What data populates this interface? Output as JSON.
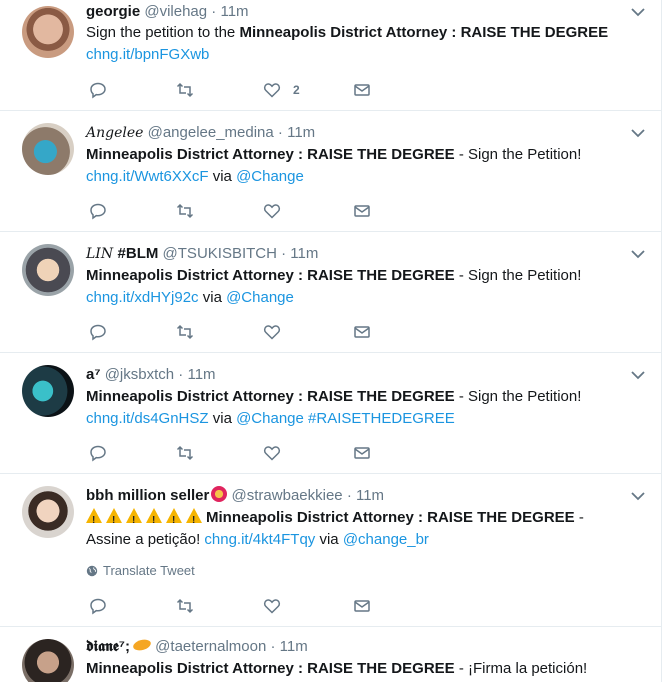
{
  "tweets": [
    {
      "display_name": "georgie",
      "handle": "@vilehag",
      "sep": "·",
      "time": "11m",
      "text_pre": "Sign the petition to the ",
      "text_bold": "Minneapolis District Attorney : RAISE THE DEGREE",
      "text_post": "",
      "link": "chng.it/bpnFGXwb",
      "like_count": "2"
    },
    {
      "display_name": "Angelee",
      "handle": "@angelee_medina",
      "sep": "·",
      "time": "11m",
      "text_bold": "Minneapolis District Attorney : RAISE THE DEGREE",
      "text_post": " - Sign the Petition!",
      "link": "chng.it/Wwt6XXcF",
      "via": " via ",
      "mention": "@Change"
    },
    {
      "display_name": "LIN",
      "display_tag": "#BLM",
      "handle": "@TSUKISBITCH",
      "sep": "·",
      "time": "11m",
      "text_bold": "Minneapolis District Attorney : RAISE THE DEGREE",
      "text_post": " - Sign the Petition!",
      "link": "chng.it/xdHYj92c",
      "via": " via ",
      "mention": "@Change"
    },
    {
      "display_name": "a⁷",
      "handle": "@jksbxtch",
      "sep": "·",
      "time": "11m",
      "text_bold": "Minneapolis District Attorney : RAISE THE DEGREE",
      "text_post": " - Sign the Petition!",
      "link": "chng.it/ds4GnHSZ",
      "via": " via ",
      "mention": "@Change",
      "hashtag": "#RAISETHEDEGREE"
    },
    {
      "display_name": "bbh million seller",
      "handle": "@strawbaekkiee",
      "sep": "·",
      "time": "11m",
      "text_bold": "Minneapolis District Attorney : RAISE THE DEGREE",
      "text_post": " -",
      "text_line2": "Assine a petição! ",
      "link": "chng.it/4kt4FTqy",
      "via": " via ",
      "mention": "@change_br",
      "translate": "Translate Tweet"
    },
    {
      "display_name": "𝖉𝖎𝖆𝖓𝖊⁷;",
      "handle": "@taeternalmoon",
      "sep": "·",
      "time": "11m",
      "text_bold": "Minneapolis District Attorney : RAISE THE DEGREE",
      "text_post": " - ¡Firma la petición!"
    }
  ],
  "icons": {
    "reply": "reply-icon",
    "retweet": "retweet-icon",
    "like": "heart-icon",
    "dm": "envelope-icon",
    "caret": "chevron-down-icon",
    "globe": "globe-icon",
    "warning": "warning-icon"
  },
  "colors": {
    "link": "#1b95e0",
    "muted": "#657786",
    "text": "#14171a",
    "divider": "#e6ecf0"
  }
}
